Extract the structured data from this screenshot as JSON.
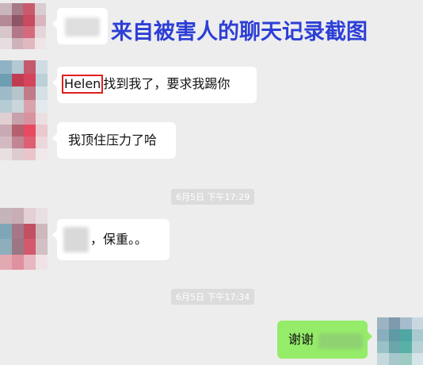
{
  "caption": "来自被害人的聊天记录截图",
  "messages": [
    {
      "name_highlight": "Helen",
      "text_after": "找到我了，要求我踢你"
    },
    {
      "text": "我顶住压力了哈"
    },
    {
      "timestamp": "6月5日 下午17:29"
    },
    {
      "text": "，保重。。"
    },
    {
      "timestamp": "6月5日 下午17:34"
    },
    {
      "text": "谢谢"
    }
  ],
  "colors": {
    "caption": "#2d3fd6",
    "highlight_box": "#e0201c",
    "my_bubble": "#95ec69",
    "background": "#ededed"
  }
}
